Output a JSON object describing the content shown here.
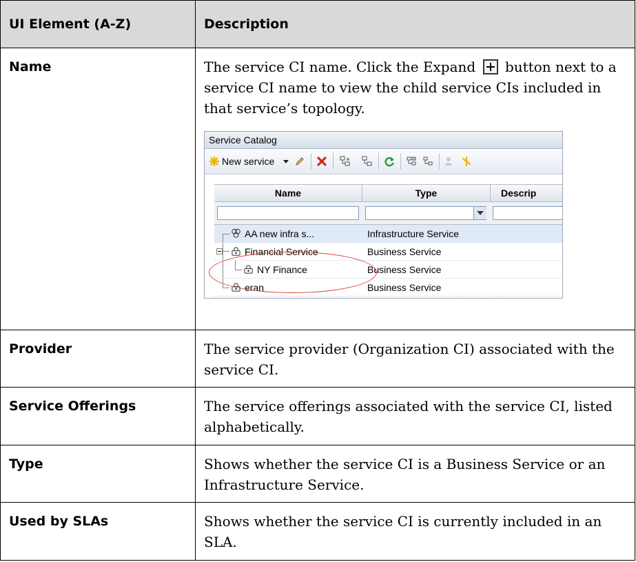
{
  "table": {
    "header": {
      "col1": "UI Element (A-Z)",
      "col2": "Description"
    },
    "rows": [
      {
        "element": "Name",
        "desc_before": "The service CI name. Click the Expand",
        "desc_after": "button next to a service CI name to view the child service CIs included in that service’s topology."
      },
      {
        "element": "Provider",
        "desc": "The service provider (Organization CI) associated with the service CI."
      },
      {
        "element": "Service Offerings",
        "desc": "The service offerings associated with the service CI, listed alphabetically."
      },
      {
        "element": "Type",
        "desc": "Shows whether the service CI is a Business Service or an Infrastructure Service."
      },
      {
        "element": "Used by SLAs",
        "desc": "Shows whether the service CI is currently included in an SLA."
      }
    ]
  },
  "screenshot": {
    "title": "Service Catalog",
    "new_service_label": "New service",
    "columns": [
      "Name",
      "Type",
      "Descrip"
    ],
    "rows": [
      {
        "name": "AA new infra s...",
        "type": "Infrastructure Service",
        "icon": "infrastructure-service-icon"
      },
      {
        "name": "Financial Service",
        "type": "Business Service",
        "icon": "business-service-icon"
      },
      {
        "name": "NY Finance",
        "type": "Business Service",
        "icon": "business-service-icon"
      },
      {
        "name": "eran",
        "type": "Business Service",
        "icon": "business-service-icon"
      }
    ]
  },
  "colors": {
    "header_bg": "#d9d9d9",
    "selected_row": "#dfe9f7",
    "highlight_ellipse": "#d9443b"
  }
}
